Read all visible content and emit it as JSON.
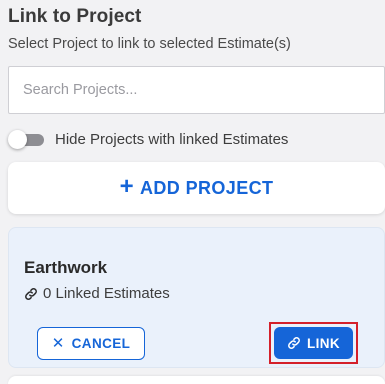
{
  "header": {
    "title": "Link to Project",
    "subtitle": "Select Project to link to selected Estimate(s)"
  },
  "search": {
    "placeholder": "Search Projects...",
    "value": ""
  },
  "filter": {
    "toggle_label": "Hide Projects with linked Estimates",
    "toggle_on": false
  },
  "add_project": {
    "icon": "+",
    "label": "ADD PROJECT"
  },
  "projects": [
    {
      "name": "Earthwork",
      "linked_estimates": "0 Linked Estimates",
      "cancel_icon": "✕",
      "cancel_label": "CANCEL",
      "link_label": "LINK"
    }
  ],
  "colors": {
    "accent": "#1565d8",
    "card_selected_bg": "#eaf1fb",
    "page_bg": "#f2f2f4",
    "highlight_border": "#d4202a"
  }
}
